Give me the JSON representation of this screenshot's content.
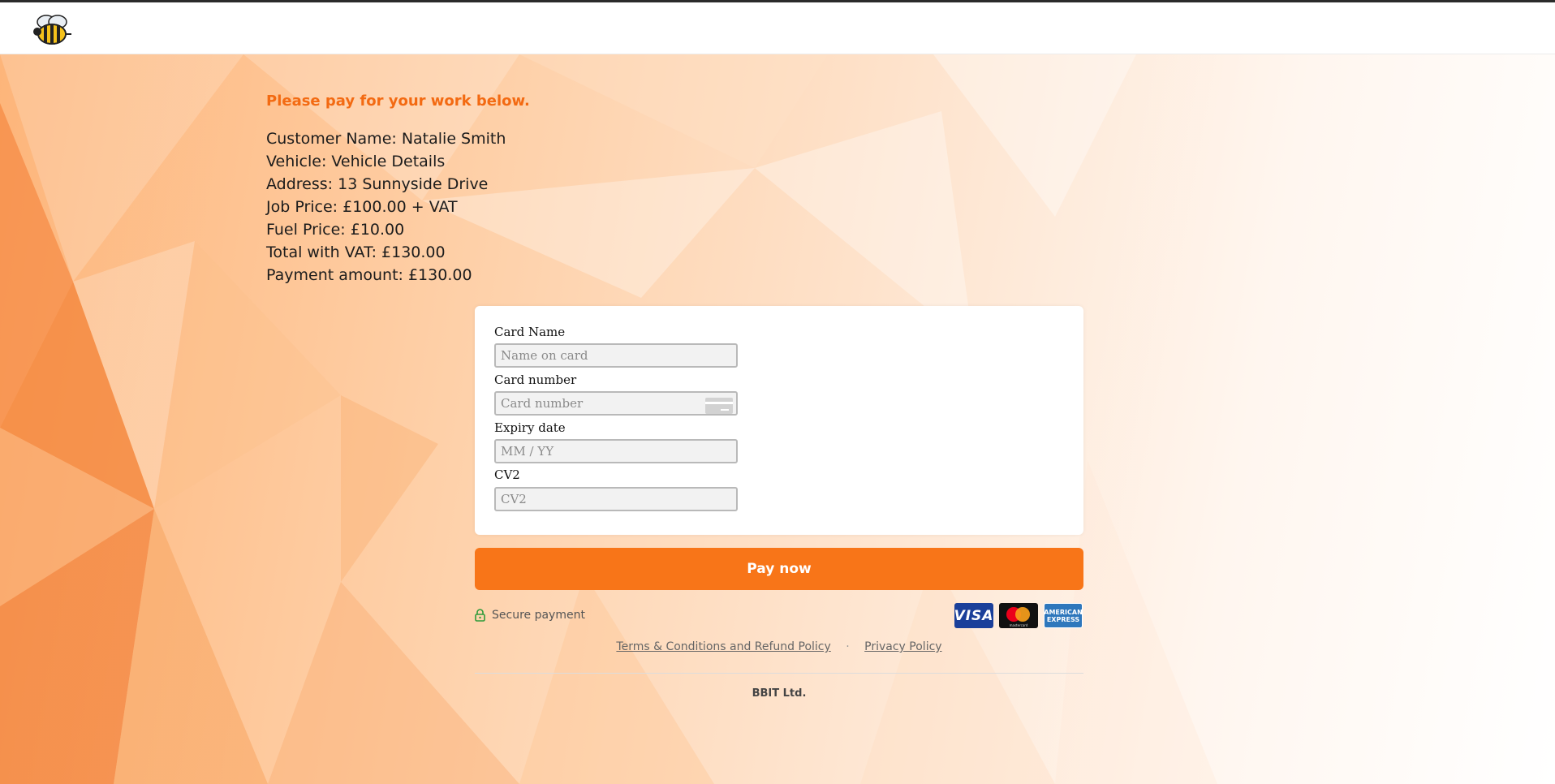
{
  "header": {
    "logo_icon": "bee-logo-icon"
  },
  "intro": "Please pay for your work below.",
  "details": [
    "Customer Name: Natalie Smith",
    "Vehicle: Vehicle Details",
    "Address: 13 Sunnyside Drive",
    "Job Price: £100.00 + VAT",
    "Fuel Price: £10.00",
    "Total with VAT: £130.00",
    "Payment amount: £130.00"
  ],
  "form": {
    "card_name": {
      "label": "Card Name",
      "placeholder": "Name on card",
      "value": ""
    },
    "card_number": {
      "label": "Card number",
      "placeholder": "Card number",
      "value": "",
      "icon": "credit-card-icon"
    },
    "expiry": {
      "label": "Expiry date",
      "placeholder": "MM / YY",
      "value": ""
    },
    "cv2": {
      "label": "CV2",
      "placeholder": "CV2",
      "value": ""
    }
  },
  "pay_button": "Pay now",
  "secure": {
    "icon": "lock-icon",
    "text": "Secure payment"
  },
  "brands": {
    "visa": "VISA",
    "mastercard": "mastercard",
    "amex_line1": "AMERICAN",
    "amex_line2": "EXPRESS"
  },
  "footer": {
    "terms_link": "Terms & Conditions and Refund Policy",
    "separator": "·",
    "privacy_link": "Privacy Policy",
    "company": "BBIT Ltd."
  },
  "colors": {
    "accent": "#f87518",
    "intro_text": "#f36a12",
    "secure_icon": "#2e9b3a"
  }
}
